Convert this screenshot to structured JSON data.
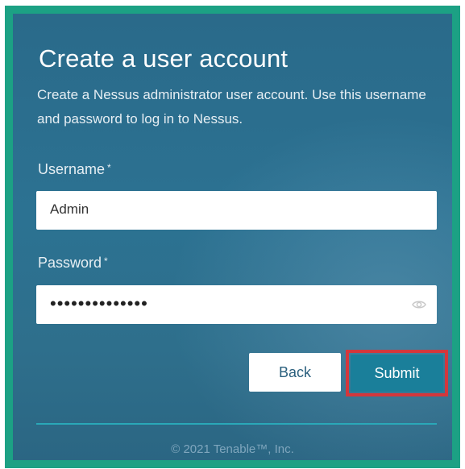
{
  "dialog": {
    "title": "Create a user account",
    "description": "Create a Nessus administrator user account. Use this username and password to log in to Nessus."
  },
  "username": {
    "label": "Username",
    "required_marker": "*",
    "value": "Admin"
  },
  "password": {
    "label": "Password",
    "required_marker": "*",
    "value": "passwordpasswd",
    "toggle_icon": "eye-icon"
  },
  "buttons": {
    "back_label": "Back",
    "submit_label": "Submit"
  },
  "footer": {
    "copyright": "© 2021 Tenable™, Inc."
  },
  "colors": {
    "frame": "#1ca184",
    "panel": "#2c7292",
    "submit": "#1a7f9a",
    "highlight": "#d3373c"
  }
}
